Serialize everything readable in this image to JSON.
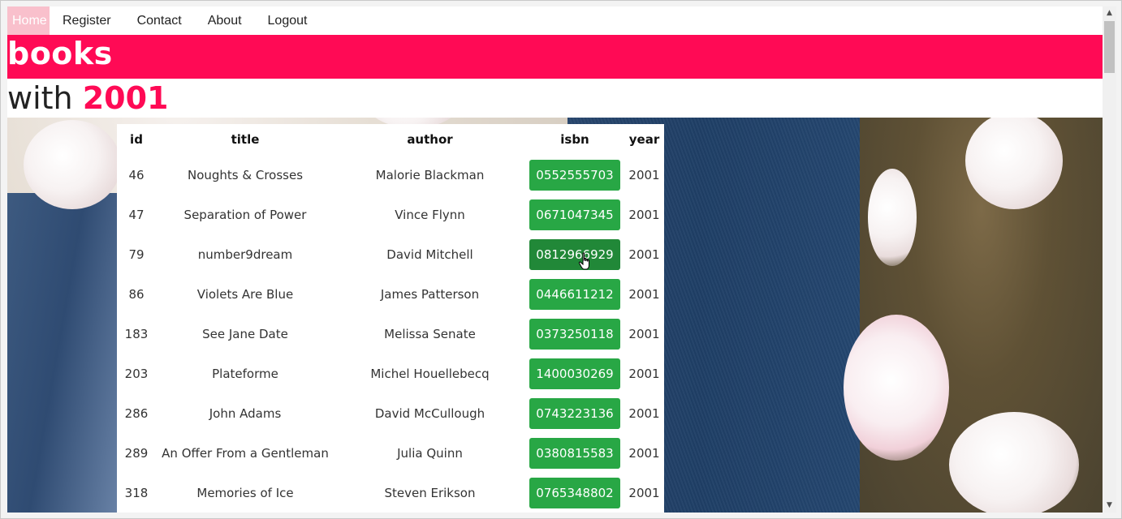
{
  "nav": {
    "items": [
      {
        "label": "Home",
        "active": true
      },
      {
        "label": "Register",
        "active": false
      },
      {
        "label": "Contact",
        "active": false
      },
      {
        "label": "About",
        "active": false
      },
      {
        "label": "Logout",
        "active": false
      }
    ]
  },
  "banner": {
    "title": "books"
  },
  "subheading": {
    "prefix": "with",
    "year": "2001"
  },
  "table": {
    "headers": {
      "id": "id",
      "title": "title",
      "author": "author",
      "isbn": "isbn",
      "year": "year"
    },
    "rows": [
      {
        "id": "46",
        "title": "Noughts & Crosses",
        "author": "Malorie Blackman",
        "isbn": "0552555703",
        "year": "2001"
      },
      {
        "id": "47",
        "title": "Separation of Power",
        "author": "Vince Flynn",
        "isbn": "0671047345",
        "year": "2001"
      },
      {
        "id": "79",
        "title": "number9dream",
        "author": "David Mitchell",
        "isbn": "0812966929",
        "year": "2001",
        "hovered": true
      },
      {
        "id": "86",
        "title": "Violets Are Blue",
        "author": "James Patterson",
        "isbn": "0446611212",
        "year": "2001"
      },
      {
        "id": "183",
        "title": "See Jane Date",
        "author": "Melissa Senate",
        "isbn": "0373250118",
        "year": "2001"
      },
      {
        "id": "203",
        "title": "Plateforme",
        "author": "Michel Houellebecq",
        "isbn": "1400030269",
        "year": "2001"
      },
      {
        "id": "286",
        "title": "John Adams",
        "author": "David McCullough",
        "isbn": "0743223136",
        "year": "2001"
      },
      {
        "id": "289",
        "title": "An Offer From a Gentleman",
        "author": "Julia Quinn",
        "isbn": "0380815583",
        "year": "2001"
      },
      {
        "id": "318",
        "title": "Memories of Ice",
        "author": "Steven Erikson",
        "isbn": "0765348802",
        "year": "2001"
      }
    ]
  },
  "colors": {
    "accent": "#ff0a55",
    "isbn_button": "#28a745",
    "isbn_button_hover": "#218838",
    "home_active": "#f9c0cc"
  },
  "icons": {
    "cursor": "hand-pointer-icon",
    "scroll_up": "scroll-up-arrow-icon",
    "scroll_down": "scroll-down-arrow-icon"
  }
}
